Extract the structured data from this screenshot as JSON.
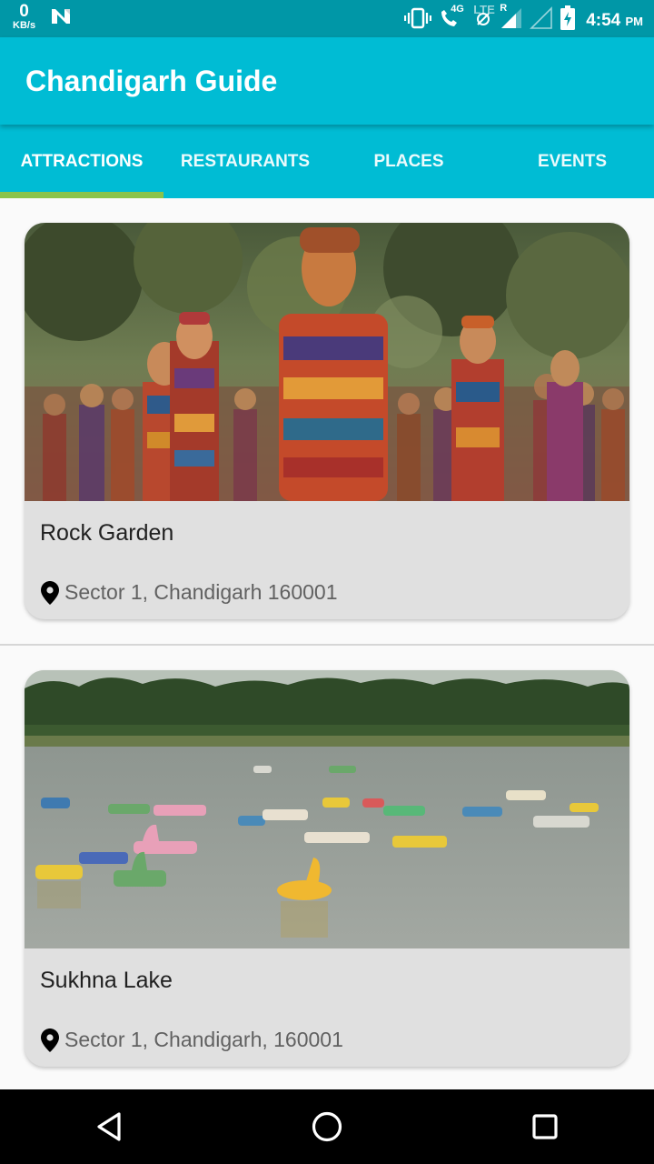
{
  "status_bar": {
    "speed_value": "0",
    "speed_unit": "KB/s",
    "network_4g": "4G",
    "network_lte": "LTE",
    "roaming": "R",
    "time": "4:54",
    "ampm": "PM"
  },
  "app_bar": {
    "title": "Chandigarh Guide"
  },
  "tabs": [
    {
      "label": "ATTRACTIONS",
      "selected": true
    },
    {
      "label": "RESTAURANTS",
      "selected": false
    },
    {
      "label": "PLACES",
      "selected": false
    },
    {
      "label": "EVENTS",
      "selected": false
    }
  ],
  "cards": [
    {
      "title": "Rock Garden",
      "location": "Sector 1, Chandigarh 160001",
      "image": "rock-garden-sculptures"
    },
    {
      "title": "Sukhna Lake",
      "location": "Sector 1, Chandigarh, 160001",
      "image": "sukhna-lake-paddle-boats"
    }
  ],
  "nav_bar": {
    "back": "back-icon",
    "home": "home-icon",
    "recents": "recents-icon"
  },
  "colors": {
    "primary": "#00bcd4",
    "primary_dark": "#0097a7",
    "accent": "#8bc34a",
    "card_bg": "#e0e0e0"
  }
}
